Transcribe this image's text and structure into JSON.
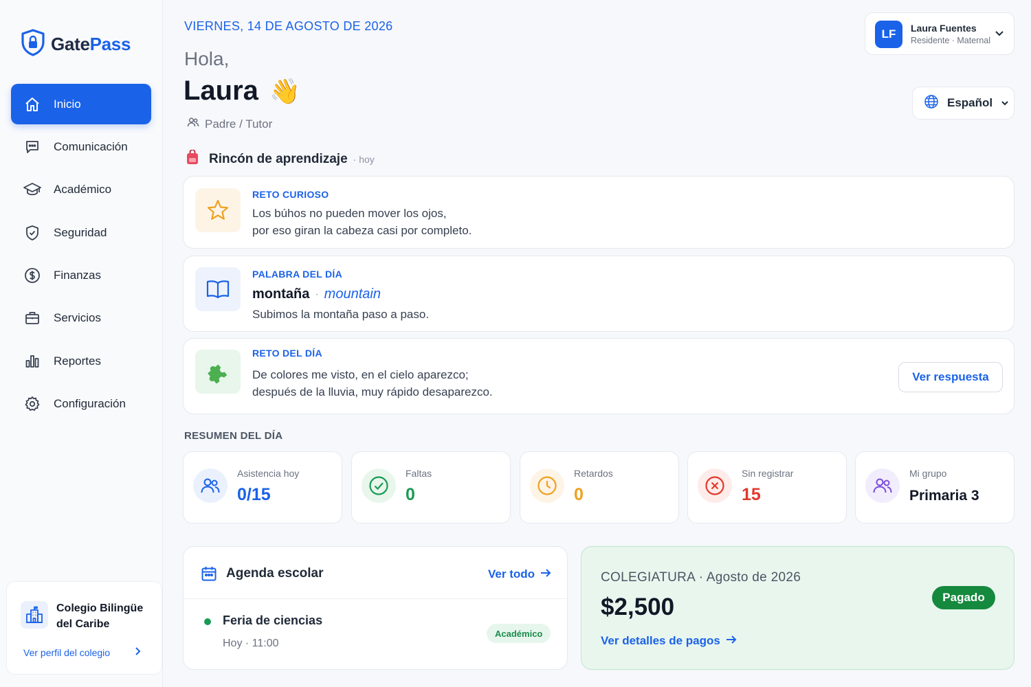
{
  "app": {
    "logo_part1": "Gate",
    "logo_part2": "Pass"
  },
  "sidebar": {
    "items": [
      {
        "label": "Inicio",
        "icon": "home-icon",
        "active": true
      },
      {
        "label": "Comunicación",
        "icon": "chat-icon"
      },
      {
        "label": "Académico",
        "icon": "graduation-cap-icon"
      },
      {
        "label": "Seguridad",
        "icon": "shield-check-icon"
      },
      {
        "label": "Finanzas",
        "icon": "dollar-icon"
      },
      {
        "label": "Servicios",
        "icon": "briefcase-icon"
      },
      {
        "label": "Reportes",
        "icon": "bar-chart-icon"
      },
      {
        "label": "Configuración",
        "icon": "gear-icon"
      }
    ],
    "school": {
      "name": "Colegio Bilingüe del Caribe",
      "link": "Ver perfil del colegio"
    }
  },
  "header": {
    "date": "VIERNES, 14 DE AGOSTO DE 2026",
    "greeting": "Hola,",
    "name": "Laura",
    "wave": "👋",
    "role": "Padre / Tutor"
  },
  "user": {
    "initials": "LF",
    "name": "Laura Fuentes",
    "subtitle": "Residente · Maternal"
  },
  "language": {
    "selected": "Español"
  },
  "learning": {
    "title": "Rincón de aprendizaje",
    "when": "· hoy",
    "curious": {
      "label": "RETO CURIOSO",
      "line1": "Los búhos no pueden mover los ojos,",
      "line2": "por eso giran la cabeza casi por completo."
    },
    "word": {
      "label": "PALABRA DEL DÍA",
      "es": "montaña",
      "sep": "·",
      "en": "mountain",
      "example": "Subimos la montaña paso a paso."
    },
    "riddle": {
      "label": "RETO DEL DÍA",
      "line1": "De colores me visto, en el cielo aparezco;",
      "line2": "después de la lluvia, muy rápido desaparezco.",
      "button": "Ver respuesta"
    }
  },
  "summary": {
    "title": "RESUMEN DEL DÍA",
    "stats": [
      {
        "label": "Asistencia hoy",
        "value": "0/15",
        "color": "#1a62e8"
      },
      {
        "label": "Faltas",
        "value": "0",
        "color": "#1a9b55"
      },
      {
        "label": "Retardos",
        "value": "0",
        "color": "#f0a020"
      },
      {
        "label": "Sin registrar",
        "value": "15",
        "color": "#e0392b"
      },
      {
        "label": "Mi grupo",
        "value": "Primaria 3",
        "color": "#111827"
      }
    ]
  },
  "agenda": {
    "title": "Agenda escolar",
    "link": "Ver todo",
    "event": {
      "title": "Feria de ciencias",
      "time": "Hoy · 11:00",
      "tag": "Académico"
    }
  },
  "tuition": {
    "label": "COLEGIATURA · Agosto de 2026",
    "amount": "$2,500",
    "link": "Ver detalles de pagos",
    "status": "Pagado"
  },
  "colors": {
    "primary": "#1a62e8",
    "success": "#15893d",
    "warning": "#f0a020",
    "danger": "#e0392b"
  }
}
